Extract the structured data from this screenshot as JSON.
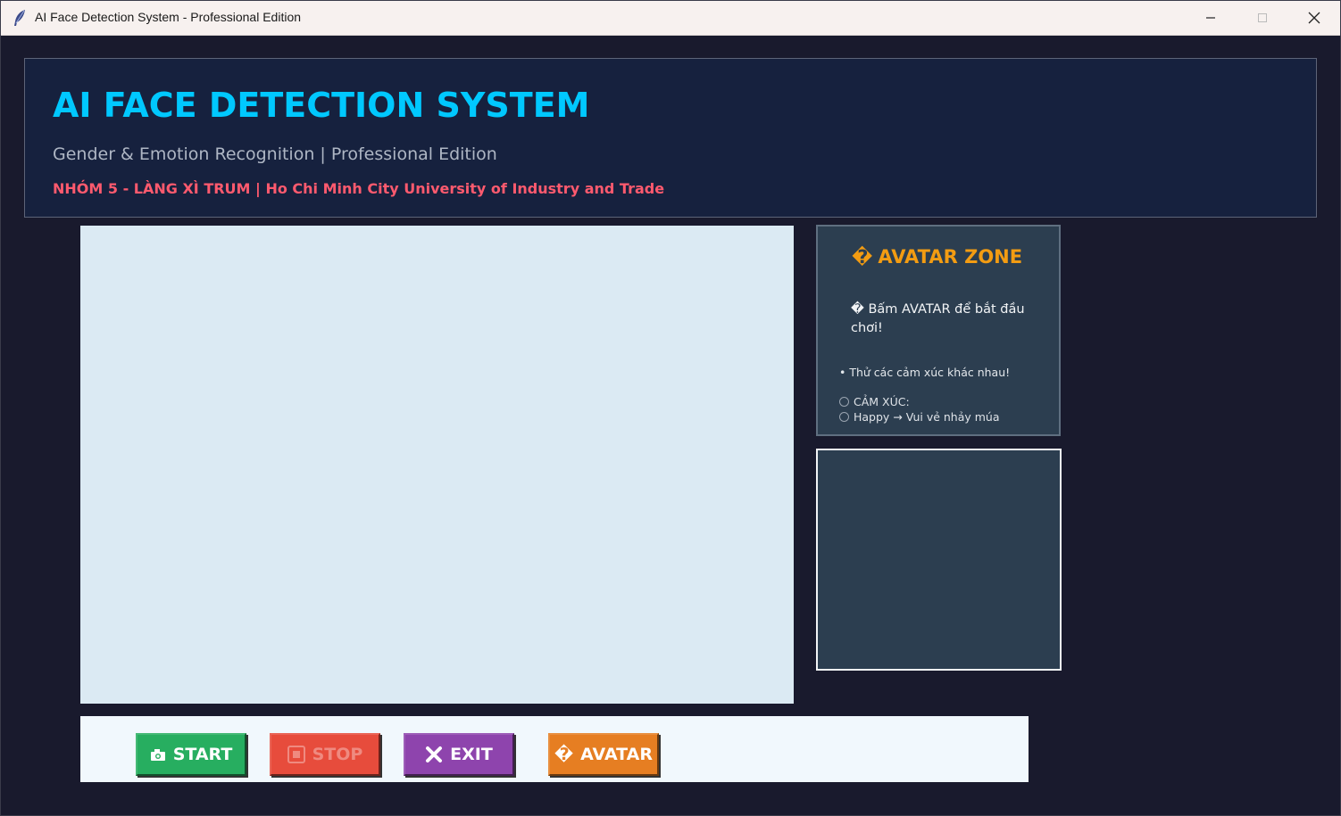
{
  "window": {
    "title": "AI Face Detection System - Professional Edition"
  },
  "header": {
    "title": "AI FACE DETECTION SYSTEM",
    "subtitle": "Gender & Emotion Recognition | Professional Edition",
    "credits": "NHÓM 5 - LÀNG XÌ TRUM | Ho Chi Minh City University of Industry and Trade"
  },
  "avatar_zone": {
    "title_glyph": "�",
    "title": "AVATAR ZONE",
    "hint": "� Bấm AVATAR để bắt đầu chơi!",
    "tip": "• Thử các cảm xúc khác nhau!",
    "emotions_heading": "CẢM XÚC:",
    "emotion_item": "Happy → Vui vẻ nhảy múa"
  },
  "controls": {
    "start_label": "START",
    "stop_label": "STOP",
    "exit_label": "EXIT",
    "avatar_glyph": "�",
    "avatar_label": "AVATAR"
  },
  "colors": {
    "title_accent": "#00c8ff",
    "credits_accent": "#ff5a6e",
    "avatar_zone_accent": "#f39c12",
    "start": "#27ae60",
    "stop": "#e74c3c",
    "exit": "#8e44ad",
    "avatar": "#e67e22"
  },
  "icons": {
    "app": "feather-icon",
    "start": "camera-icon",
    "stop": "stop-square-icon",
    "exit": "close-x-icon"
  }
}
